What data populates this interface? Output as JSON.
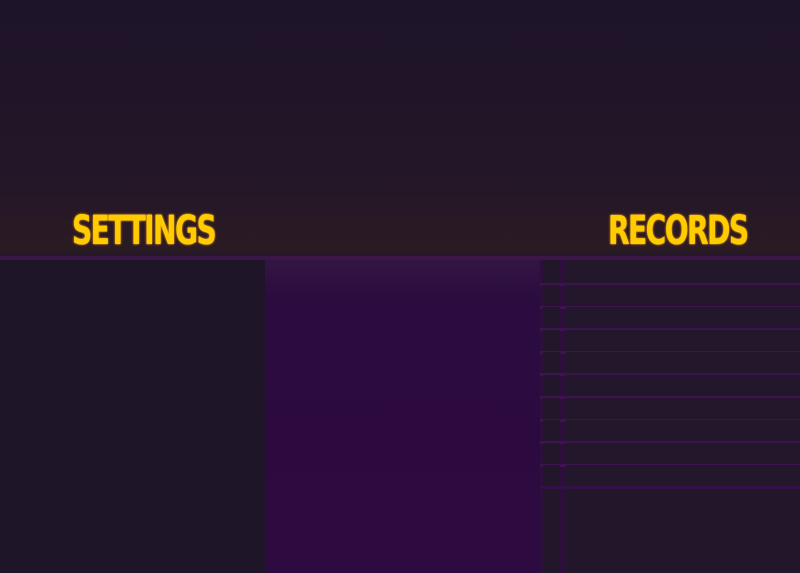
{
  "tabs": {
    "settings_label": "SETTINGS",
    "records_label": "RECORDS"
  },
  "records": {
    "rows": [
      {
        "rank": "",
        "score": ""
      },
      {
        "rank": "",
        "score": ""
      },
      {
        "rank": "",
        "score": ""
      },
      {
        "rank": "",
        "score": ""
      },
      {
        "rank": "",
        "score": ""
      },
      {
        "rank": "",
        "score": ""
      },
      {
        "rank": "",
        "score": ""
      },
      {
        "rank": "",
        "score": ""
      },
      {
        "rank": "",
        "score": ""
      },
      {
        "rank": "",
        "score": ""
      }
    ]
  },
  "colors": {
    "title": "#ffcc00",
    "background": "#1f1528",
    "accent_purple": "#2d0a40",
    "row_separator": "#3f1350"
  }
}
